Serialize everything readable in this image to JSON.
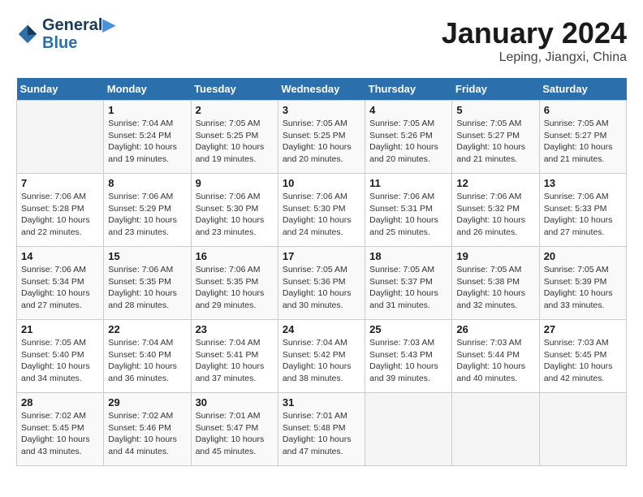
{
  "header": {
    "logo_line1": "General",
    "logo_line2": "Blue",
    "month_title": "January 2024",
    "location": "Leping, Jiangxi, China"
  },
  "weekdays": [
    "Sunday",
    "Monday",
    "Tuesday",
    "Wednesday",
    "Thursday",
    "Friday",
    "Saturday"
  ],
  "weeks": [
    [
      {
        "day": "",
        "info": ""
      },
      {
        "day": "1",
        "info": "Sunrise: 7:04 AM\nSunset: 5:24 PM\nDaylight: 10 hours\nand 19 minutes."
      },
      {
        "day": "2",
        "info": "Sunrise: 7:05 AM\nSunset: 5:25 PM\nDaylight: 10 hours\nand 19 minutes."
      },
      {
        "day": "3",
        "info": "Sunrise: 7:05 AM\nSunset: 5:25 PM\nDaylight: 10 hours\nand 20 minutes."
      },
      {
        "day": "4",
        "info": "Sunrise: 7:05 AM\nSunset: 5:26 PM\nDaylight: 10 hours\nand 20 minutes."
      },
      {
        "day": "5",
        "info": "Sunrise: 7:05 AM\nSunset: 5:27 PM\nDaylight: 10 hours\nand 21 minutes."
      },
      {
        "day": "6",
        "info": "Sunrise: 7:05 AM\nSunset: 5:27 PM\nDaylight: 10 hours\nand 21 minutes."
      }
    ],
    [
      {
        "day": "7",
        "info": "Sunrise: 7:06 AM\nSunset: 5:28 PM\nDaylight: 10 hours\nand 22 minutes."
      },
      {
        "day": "8",
        "info": "Sunrise: 7:06 AM\nSunset: 5:29 PM\nDaylight: 10 hours\nand 23 minutes."
      },
      {
        "day": "9",
        "info": "Sunrise: 7:06 AM\nSunset: 5:30 PM\nDaylight: 10 hours\nand 23 minutes."
      },
      {
        "day": "10",
        "info": "Sunrise: 7:06 AM\nSunset: 5:30 PM\nDaylight: 10 hours\nand 24 minutes."
      },
      {
        "day": "11",
        "info": "Sunrise: 7:06 AM\nSunset: 5:31 PM\nDaylight: 10 hours\nand 25 minutes."
      },
      {
        "day": "12",
        "info": "Sunrise: 7:06 AM\nSunset: 5:32 PM\nDaylight: 10 hours\nand 26 minutes."
      },
      {
        "day": "13",
        "info": "Sunrise: 7:06 AM\nSunset: 5:33 PM\nDaylight: 10 hours\nand 27 minutes."
      }
    ],
    [
      {
        "day": "14",
        "info": "Sunrise: 7:06 AM\nSunset: 5:34 PM\nDaylight: 10 hours\nand 27 minutes."
      },
      {
        "day": "15",
        "info": "Sunrise: 7:06 AM\nSunset: 5:35 PM\nDaylight: 10 hours\nand 28 minutes."
      },
      {
        "day": "16",
        "info": "Sunrise: 7:06 AM\nSunset: 5:35 PM\nDaylight: 10 hours\nand 29 minutes."
      },
      {
        "day": "17",
        "info": "Sunrise: 7:05 AM\nSunset: 5:36 PM\nDaylight: 10 hours\nand 30 minutes."
      },
      {
        "day": "18",
        "info": "Sunrise: 7:05 AM\nSunset: 5:37 PM\nDaylight: 10 hours\nand 31 minutes."
      },
      {
        "day": "19",
        "info": "Sunrise: 7:05 AM\nSunset: 5:38 PM\nDaylight: 10 hours\nand 32 minutes."
      },
      {
        "day": "20",
        "info": "Sunrise: 7:05 AM\nSunset: 5:39 PM\nDaylight: 10 hours\nand 33 minutes."
      }
    ],
    [
      {
        "day": "21",
        "info": "Sunrise: 7:05 AM\nSunset: 5:40 PM\nDaylight: 10 hours\nand 34 minutes."
      },
      {
        "day": "22",
        "info": "Sunrise: 7:04 AM\nSunset: 5:40 PM\nDaylight: 10 hours\nand 36 minutes."
      },
      {
        "day": "23",
        "info": "Sunrise: 7:04 AM\nSunset: 5:41 PM\nDaylight: 10 hours\nand 37 minutes."
      },
      {
        "day": "24",
        "info": "Sunrise: 7:04 AM\nSunset: 5:42 PM\nDaylight: 10 hours\nand 38 minutes."
      },
      {
        "day": "25",
        "info": "Sunrise: 7:03 AM\nSunset: 5:43 PM\nDaylight: 10 hours\nand 39 minutes."
      },
      {
        "day": "26",
        "info": "Sunrise: 7:03 AM\nSunset: 5:44 PM\nDaylight: 10 hours\nand 40 minutes."
      },
      {
        "day": "27",
        "info": "Sunrise: 7:03 AM\nSunset: 5:45 PM\nDaylight: 10 hours\nand 42 minutes."
      }
    ],
    [
      {
        "day": "28",
        "info": "Sunrise: 7:02 AM\nSunset: 5:45 PM\nDaylight: 10 hours\nand 43 minutes."
      },
      {
        "day": "29",
        "info": "Sunrise: 7:02 AM\nSunset: 5:46 PM\nDaylight: 10 hours\nand 44 minutes."
      },
      {
        "day": "30",
        "info": "Sunrise: 7:01 AM\nSunset: 5:47 PM\nDaylight: 10 hours\nand 45 minutes."
      },
      {
        "day": "31",
        "info": "Sunrise: 7:01 AM\nSunset: 5:48 PM\nDaylight: 10 hours\nand 47 minutes."
      },
      {
        "day": "",
        "info": ""
      },
      {
        "day": "",
        "info": ""
      },
      {
        "day": "",
        "info": ""
      }
    ]
  ]
}
